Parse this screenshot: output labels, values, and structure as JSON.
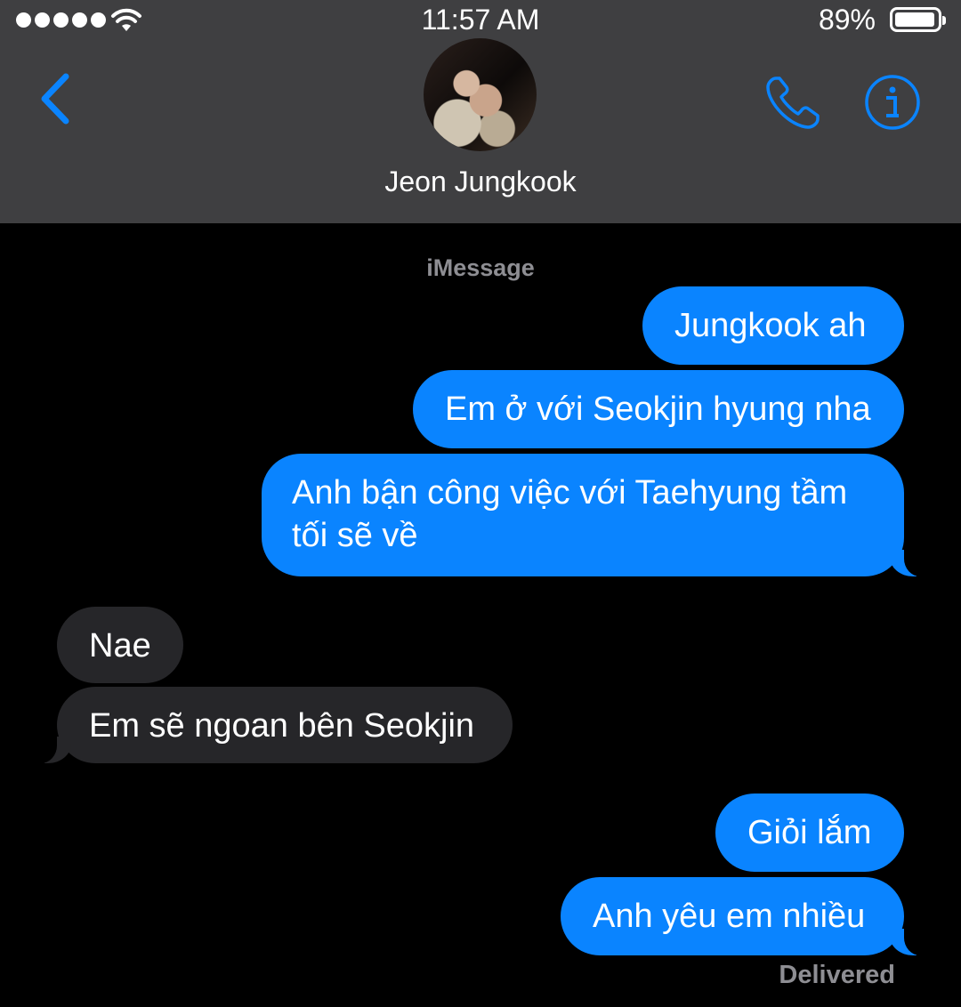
{
  "status_bar": {
    "time": "11:57 AM",
    "battery_percent": "89%",
    "battery_level": 0.89,
    "signal_bars": 5
  },
  "header": {
    "contact_name": "Jeon Jungkook",
    "accent_color": "#0a84ff",
    "icons": [
      "chevron-left-icon",
      "phone-icon",
      "info-icon"
    ]
  },
  "conversation": {
    "service_label": "iMessage",
    "messages": [
      {
        "from": "me",
        "text": "Jungkook ah"
      },
      {
        "from": "me",
        "text": "Em ở với Seokjin hyung nha"
      },
      {
        "from": "me",
        "text_lines": [
          "Anh bận công việc với Taehyung tầm",
          "tối sẽ về"
        ]
      },
      {
        "from": "them",
        "text": "Nae"
      },
      {
        "from": "them",
        "text": "Em sẽ ngoan bên Seokjin"
      },
      {
        "from": "me",
        "text": "Giỏi lắm"
      },
      {
        "from": "me",
        "text": "Anh yêu em nhiều"
      }
    ],
    "delivery_status": "Delivered"
  },
  "colors": {
    "sent_bubble": "#0a84ff",
    "received_bubble": "#262629",
    "header_bg": "#3f3f41",
    "background": "#000000"
  }
}
